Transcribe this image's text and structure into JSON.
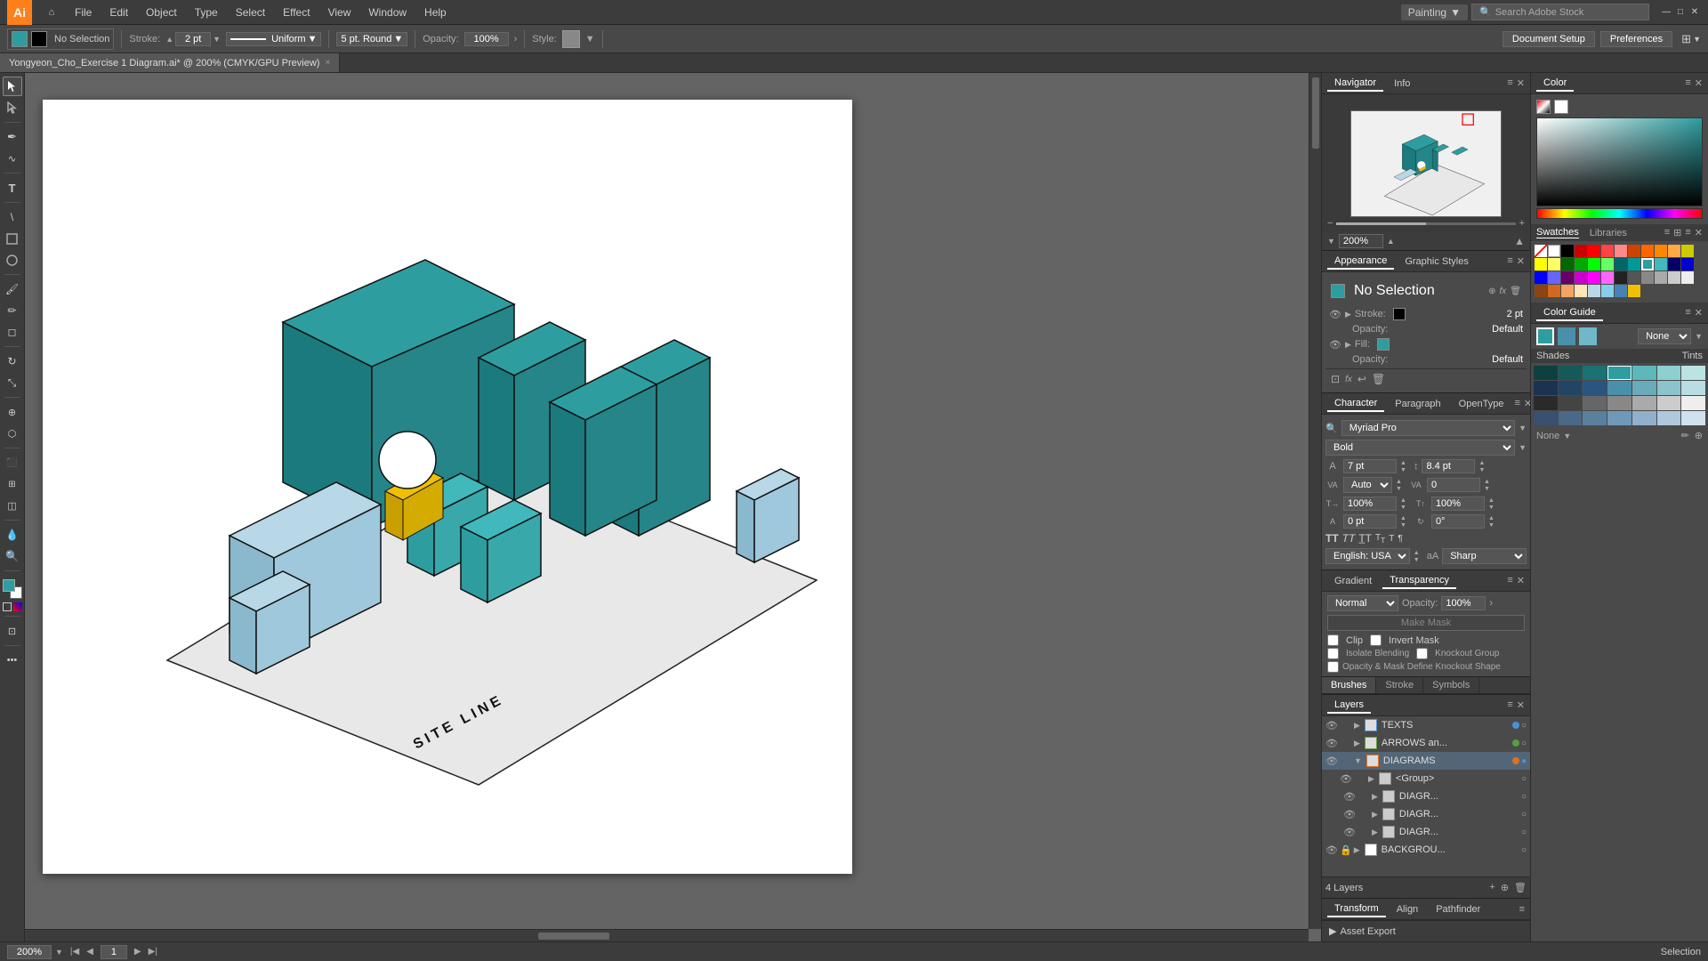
{
  "app": {
    "name": "Adobe Illustrator",
    "logo": "Ai"
  },
  "menu": {
    "items": [
      "File",
      "Edit",
      "Object",
      "Type",
      "Select",
      "Effect",
      "View",
      "Window",
      "Help"
    ],
    "workspace": "Painting",
    "stock_search_placeholder": "Search Adobe Stock"
  },
  "toolbar_top": {
    "selection_label": "No Selection",
    "stroke_label": "Stroke:",
    "stroke_value": "2 pt",
    "stroke_type": "Uniform",
    "brush_size": "5 pt. Round",
    "opacity_label": "Opacity:",
    "opacity_value": "100%",
    "style_label": "Style:",
    "doc_setup_btn": "Document Setup",
    "preferences_btn": "Preferences"
  },
  "tab": {
    "filename": "Yongyeon_Cho_Exercise 1 Diagram.ai* @ 200% (CMYK/GPU Preview)",
    "close": "×"
  },
  "status_bar": {
    "zoom_value": "200%",
    "page_label": "1",
    "mode": "Selection"
  },
  "navigator": {
    "tab_navigator": "Navigator",
    "tab_info": "Info",
    "zoom_value": "200%"
  },
  "appearance": {
    "tab": "Appearance",
    "tab_graphic": "Graphic Styles",
    "no_selection": "No Selection",
    "stroke_label": "Stroke:",
    "stroke_value": "2 pt",
    "opacity_label": "Opacity:",
    "opacity_value": "Default",
    "fill_label": "Fill:",
    "fill_opacity_label": "Opacity:",
    "fill_opacity_value": "Default"
  },
  "character": {
    "tab": "Character",
    "tab_paragraph": "Paragraph",
    "tab_opentype": "OpenType",
    "font_name": "Myriad Pro",
    "font_style": "Bold",
    "font_size": "7 pt",
    "leading": "8.4 pt",
    "tracking": "Auto",
    "kerning": "0",
    "scale_h": "100%",
    "scale_v": "100%",
    "baseline": "0 pt",
    "rotate": "0°",
    "language": "English: USA",
    "anti_alias": "Sharp"
  },
  "color": {
    "tab": "Color",
    "swatches_tab": "Swatches",
    "libraries_tab": "Libraries"
  },
  "color_guide": {
    "tab": "Color Guide",
    "shades_label": "Shades",
    "tints_label": "Tints",
    "harmony": "None"
  },
  "brushes_tabs": {
    "brushes": "Brushes",
    "stroke": "Stroke",
    "symbols": "Symbols"
  },
  "layers": {
    "title": "Layers",
    "count": "4 Layers",
    "items": [
      {
        "name": "TEXTS",
        "indent": 0,
        "visible": true,
        "locked": false,
        "color": "blue"
      },
      {
        "name": "ARROWS an...",
        "indent": 0,
        "visible": true,
        "locked": false,
        "color": "green"
      },
      {
        "name": "DIAGRAMS",
        "indent": 0,
        "visible": true,
        "locked": false,
        "expanded": true,
        "color": "orange"
      },
      {
        "name": "<Group>",
        "indent": 1,
        "visible": true,
        "locked": false
      },
      {
        "name": "DIAGR...",
        "indent": 1,
        "visible": true,
        "locked": false
      },
      {
        "name": "DIAGR...",
        "indent": 1,
        "visible": true,
        "locked": false
      },
      {
        "name": "DIAGR...",
        "indent": 1,
        "visible": true,
        "locked": false
      },
      {
        "name": "BACKGROU...",
        "indent": 0,
        "visible": true,
        "locked": true
      }
    ]
  },
  "gradient": {
    "tab": "Gradient",
    "transparency_tab": "Transparency",
    "mode": "Normal",
    "opacity_label": "Opacity:",
    "opacity_value": "100%",
    "clip_label": "Clip",
    "invert_label": "Invert Mask",
    "isolate_label": "Isolate Blending",
    "knockout_label": "Knockout Group",
    "opacity_mask_label": "Opacity & Mask Define Knockout Shape",
    "make_mask_btn": "Make Mask"
  },
  "transform": {
    "tab": "Transform",
    "align_tab": "Align",
    "pathfinder_tab": "Pathfinder"
  },
  "asset_export": {
    "label": "Asset Export"
  },
  "swatches": {
    "white": "#ffffff",
    "black": "#000000",
    "red": "#ff0000",
    "orange": "#ff8000",
    "yellow": "#ffff00",
    "green": "#00ff00",
    "teal": "#00ffff",
    "blue": "#0000ff",
    "magenta": "#ff00ff"
  }
}
